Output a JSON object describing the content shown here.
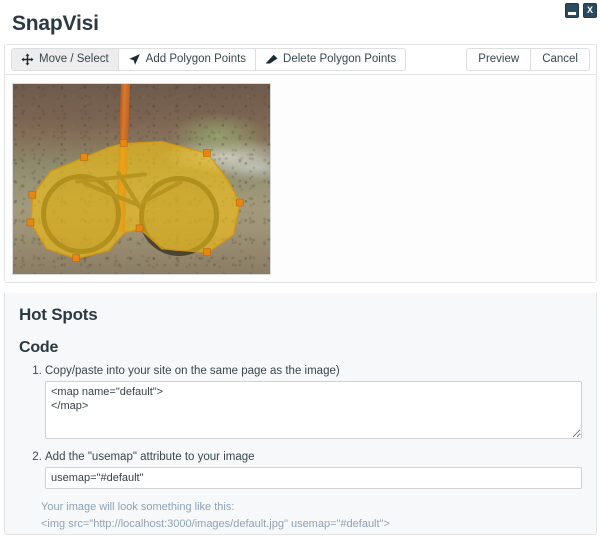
{
  "window": {
    "minimize_label": "_",
    "close_label": "X"
  },
  "app": {
    "title": "SnapVisi"
  },
  "toolbar": {
    "tools": [
      {
        "label": "Move / Select",
        "icon": "move-arrows-icon",
        "active": true
      },
      {
        "label": "Add Polygon Points",
        "icon": "cursor-arrow-icon",
        "active": false
      },
      {
        "label": "Delete Polygon Points",
        "icon": "eraser-icon",
        "active": false
      }
    ],
    "preview_label": "Preview",
    "cancel_label": "Cancel"
  },
  "workspace": {
    "image_alt": "bicycle-leaning-on-orange-post-photo",
    "hotspot_shape": "bicycle-polygon"
  },
  "hotspots": {
    "heading": "Hot Spots",
    "code_heading": "Code",
    "steps": [
      {
        "label": "Copy/paste into your site on the same page as the image)",
        "value": "<map name=\"default\">\n</map>"
      },
      {
        "label": "Add the \"usemap\" attribute to your image",
        "value": "usemap=\"#default\""
      }
    ],
    "hint_intro": "Your image will look something like this:",
    "hint_code": "<img src=\"http://localhost:3000/images/default.jpg\" usemap=\"#default\">"
  },
  "colors": {
    "hotspot_fill": "#f2be12",
    "hotspot_stroke": "#d6960c",
    "post_orange": "#d8792c",
    "window_button": "#2c4a5e",
    "hint_text": "#8fa3b5",
    "panel_bg": "#f7f8f9"
  }
}
